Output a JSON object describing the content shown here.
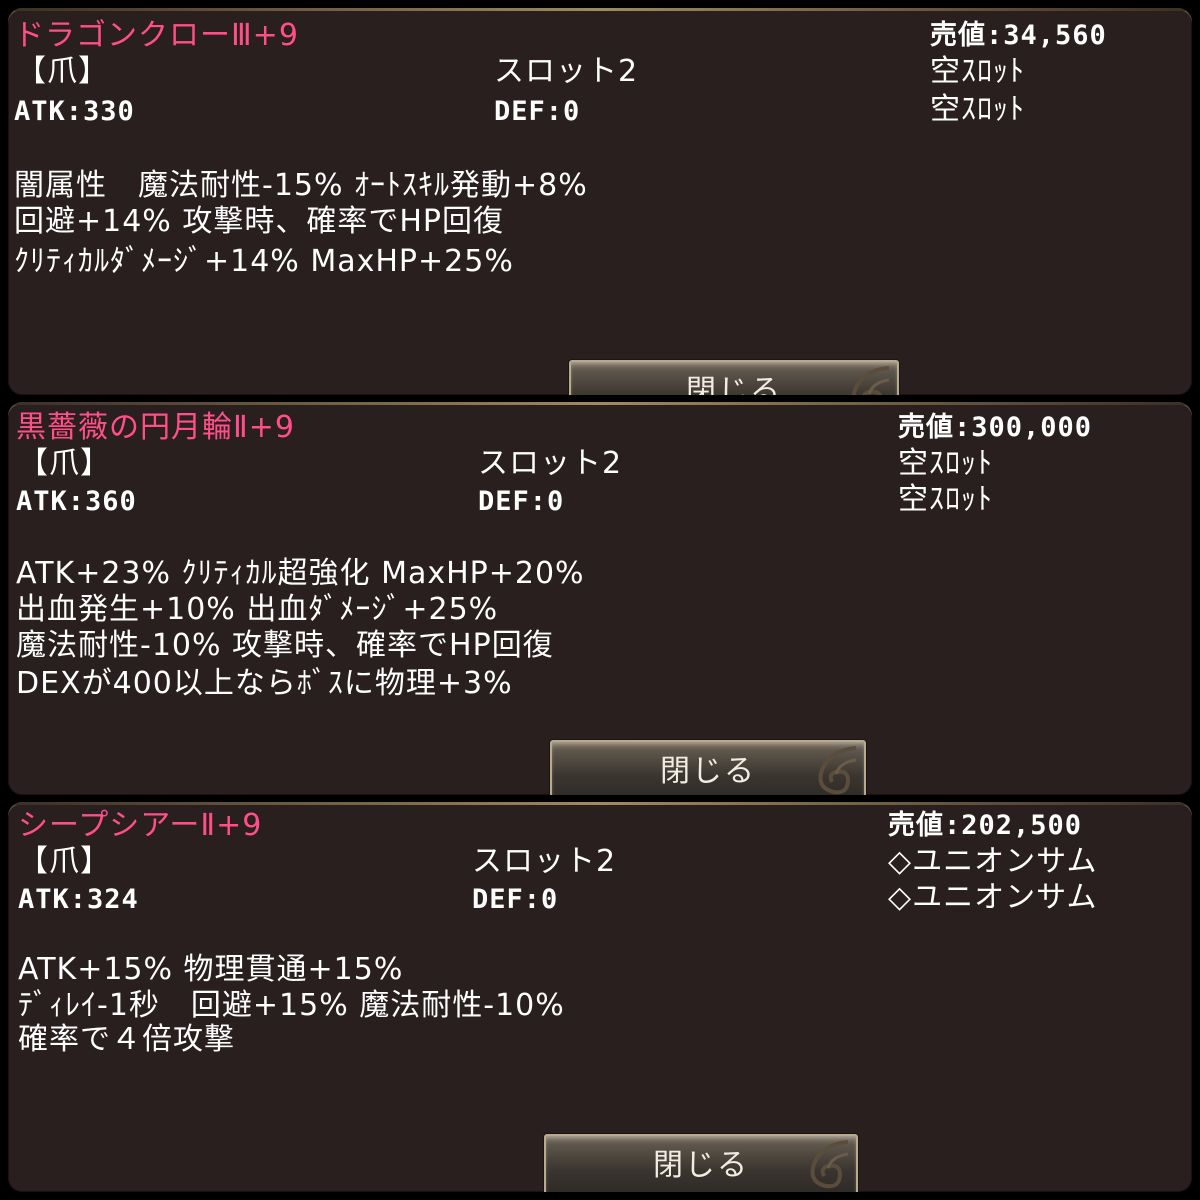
{
  "close_label": "閉じる",
  "items": [
    {
      "name": "ドラゴンクローⅢ+9",
      "price": "売値:34,560",
      "category": "【爪】",
      "slots": "スロット2",
      "slot_1": "空ｽﾛｯﾄ",
      "slot_2": "空ｽﾛｯﾄ",
      "atk": "ATK:330",
      "def": "DEF:0",
      "effects": [
        "闇属性　魔法耐性-15% ｵｰﾄｽｷﾙ発動+8%",
        "回避+14% 攻撃時、確率でHP回復",
        "ｸﾘﾃｨｶﾙﾀﾞﾒｰｼﾞ+14% MaxHP+25%"
      ]
    },
    {
      "name": "黒薔薇の円月輪Ⅱ+9",
      "price": "売値:300,000",
      "category": "【爪】",
      "slots": "スロット2",
      "slot_1": "空ｽﾛｯﾄ",
      "slot_2": "空ｽﾛｯﾄ",
      "atk": "ATK:360",
      "def": "DEF:0",
      "effects": [
        "ATK+23% ｸﾘﾃｨｶﾙ超強化 MaxHP+20%",
        "出血発生+10% 出血ﾀﾞﾒｰｼﾞ+25%",
        "魔法耐性-10% 攻撃時、確率でHP回復",
        "DEXが400以上ならﾎﾞｽに物理+3%"
      ]
    },
    {
      "name": "シープシアーⅡ+9",
      "price": "売値:202,500",
      "category": "【爪】",
      "slots": "スロット2",
      "slot_1": "◇ユニオンサム",
      "slot_2": "◇ユニオンサム",
      "atk": "ATK:324",
      "def": "DEF:0",
      "effects": [
        "ATK+15% 物理貫通+15%",
        "ﾃﾞｨﾚｲ-1秒　回避+15% 魔法耐性-10%",
        "確率で４倍攻撃"
      ]
    }
  ],
  "colors": {
    "panel_bg": "#2a1f1f",
    "item_name": "#ff4f8b",
    "text": "#ffffff"
  },
  "icons": {
    "button_ornament": "swirl-ornament-icon"
  }
}
